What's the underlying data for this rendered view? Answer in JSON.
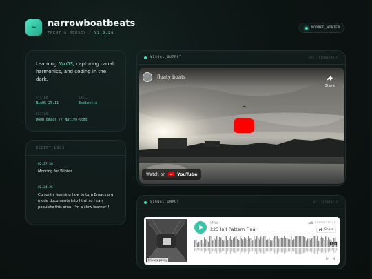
{
  "header": {
    "logo_glyph": "~",
    "site_title": "narrowboatbeats",
    "subtitle_names": "TRENT & MERSEY",
    "subtitle_sep": " / ",
    "subtitle_version": "V2.0.26",
    "status": "MOORED_WINTER"
  },
  "about": {
    "intro_before": "Learning ",
    "intro_em": "NixOS",
    "intro_after": ", capturing canal harmonics, and coding in the dark.",
    "specs": [
      {
        "label": "SYSTEM",
        "value": "NixOS 25.11"
      },
      {
        "label": "SHELL",
        "value": "Eselectie"
      },
      {
        "label": "EDITOR",
        "value": "Doom Emacs // Native-Comp"
      }
    ]
  },
  "logs": {
    "title": "RECENT_LOGS",
    "entries": [
      {
        "date": "02.27.26",
        "text": "Mooring for Winter"
      },
      {
        "date": "02.24.26",
        "text": "Currently learning how to turn Emacs org mode documents into html so I can populate this area! I'm a slow learner!!"
      }
    ]
  },
  "video_card": {
    "title": "VISUAL_OUTPUT",
    "ref": "FT://QLUB0TBOIC",
    "video_title": "floaty boats",
    "share_label": "Share",
    "watch_on": "Watch on",
    "youtube_word": "YouTube"
  },
  "audio_card": {
    "title": "SIGNAL_INPUT",
    "ref": "SC://ZCNBHT-5",
    "artist": "Mitd",
    "track": "223 Init Pattern Final",
    "brand": "SOUNDCLOUD",
    "share_label": "Share",
    "privacy": "Privacy policy",
    "play_count": "3:00"
  },
  "colors": {
    "accent": "#7ee2c8",
    "status_green": "#3fe0b5",
    "youtube_red": "#ff0000",
    "soundcloud_teal": "#36c6a7"
  }
}
